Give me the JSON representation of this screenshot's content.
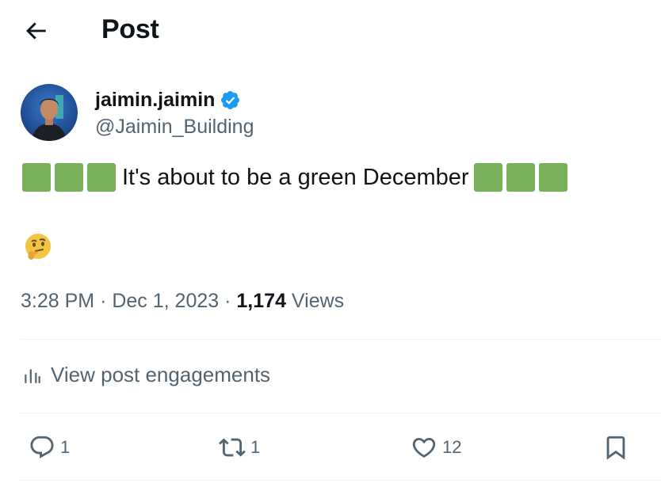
{
  "header": {
    "title": "Post",
    "back_icon": "arrow-left-icon"
  },
  "author": {
    "name": "jaimin.jaimin",
    "handle": "@Jaimin_Building",
    "verified": true
  },
  "post": {
    "text": "It's about to be a green December",
    "emoji_prefix": [
      "green-square",
      "green-square",
      "green-square"
    ],
    "emoji_suffix": [
      "green-square",
      "green-square",
      "green-square"
    ],
    "second_line_emoji": "thinking-face-emoji",
    "time": "3:28 PM",
    "date": "Dec 1, 2023",
    "views_count": "1,174",
    "views_label": "Views"
  },
  "engagements": {
    "label": "View post engagements"
  },
  "actions": {
    "reply_count": "1",
    "repost_count": "1",
    "like_count": "12"
  },
  "colors": {
    "accent": "#1d9bf0",
    "green_square": "#78b159",
    "muted": "#536471",
    "text": "#0f1419"
  }
}
